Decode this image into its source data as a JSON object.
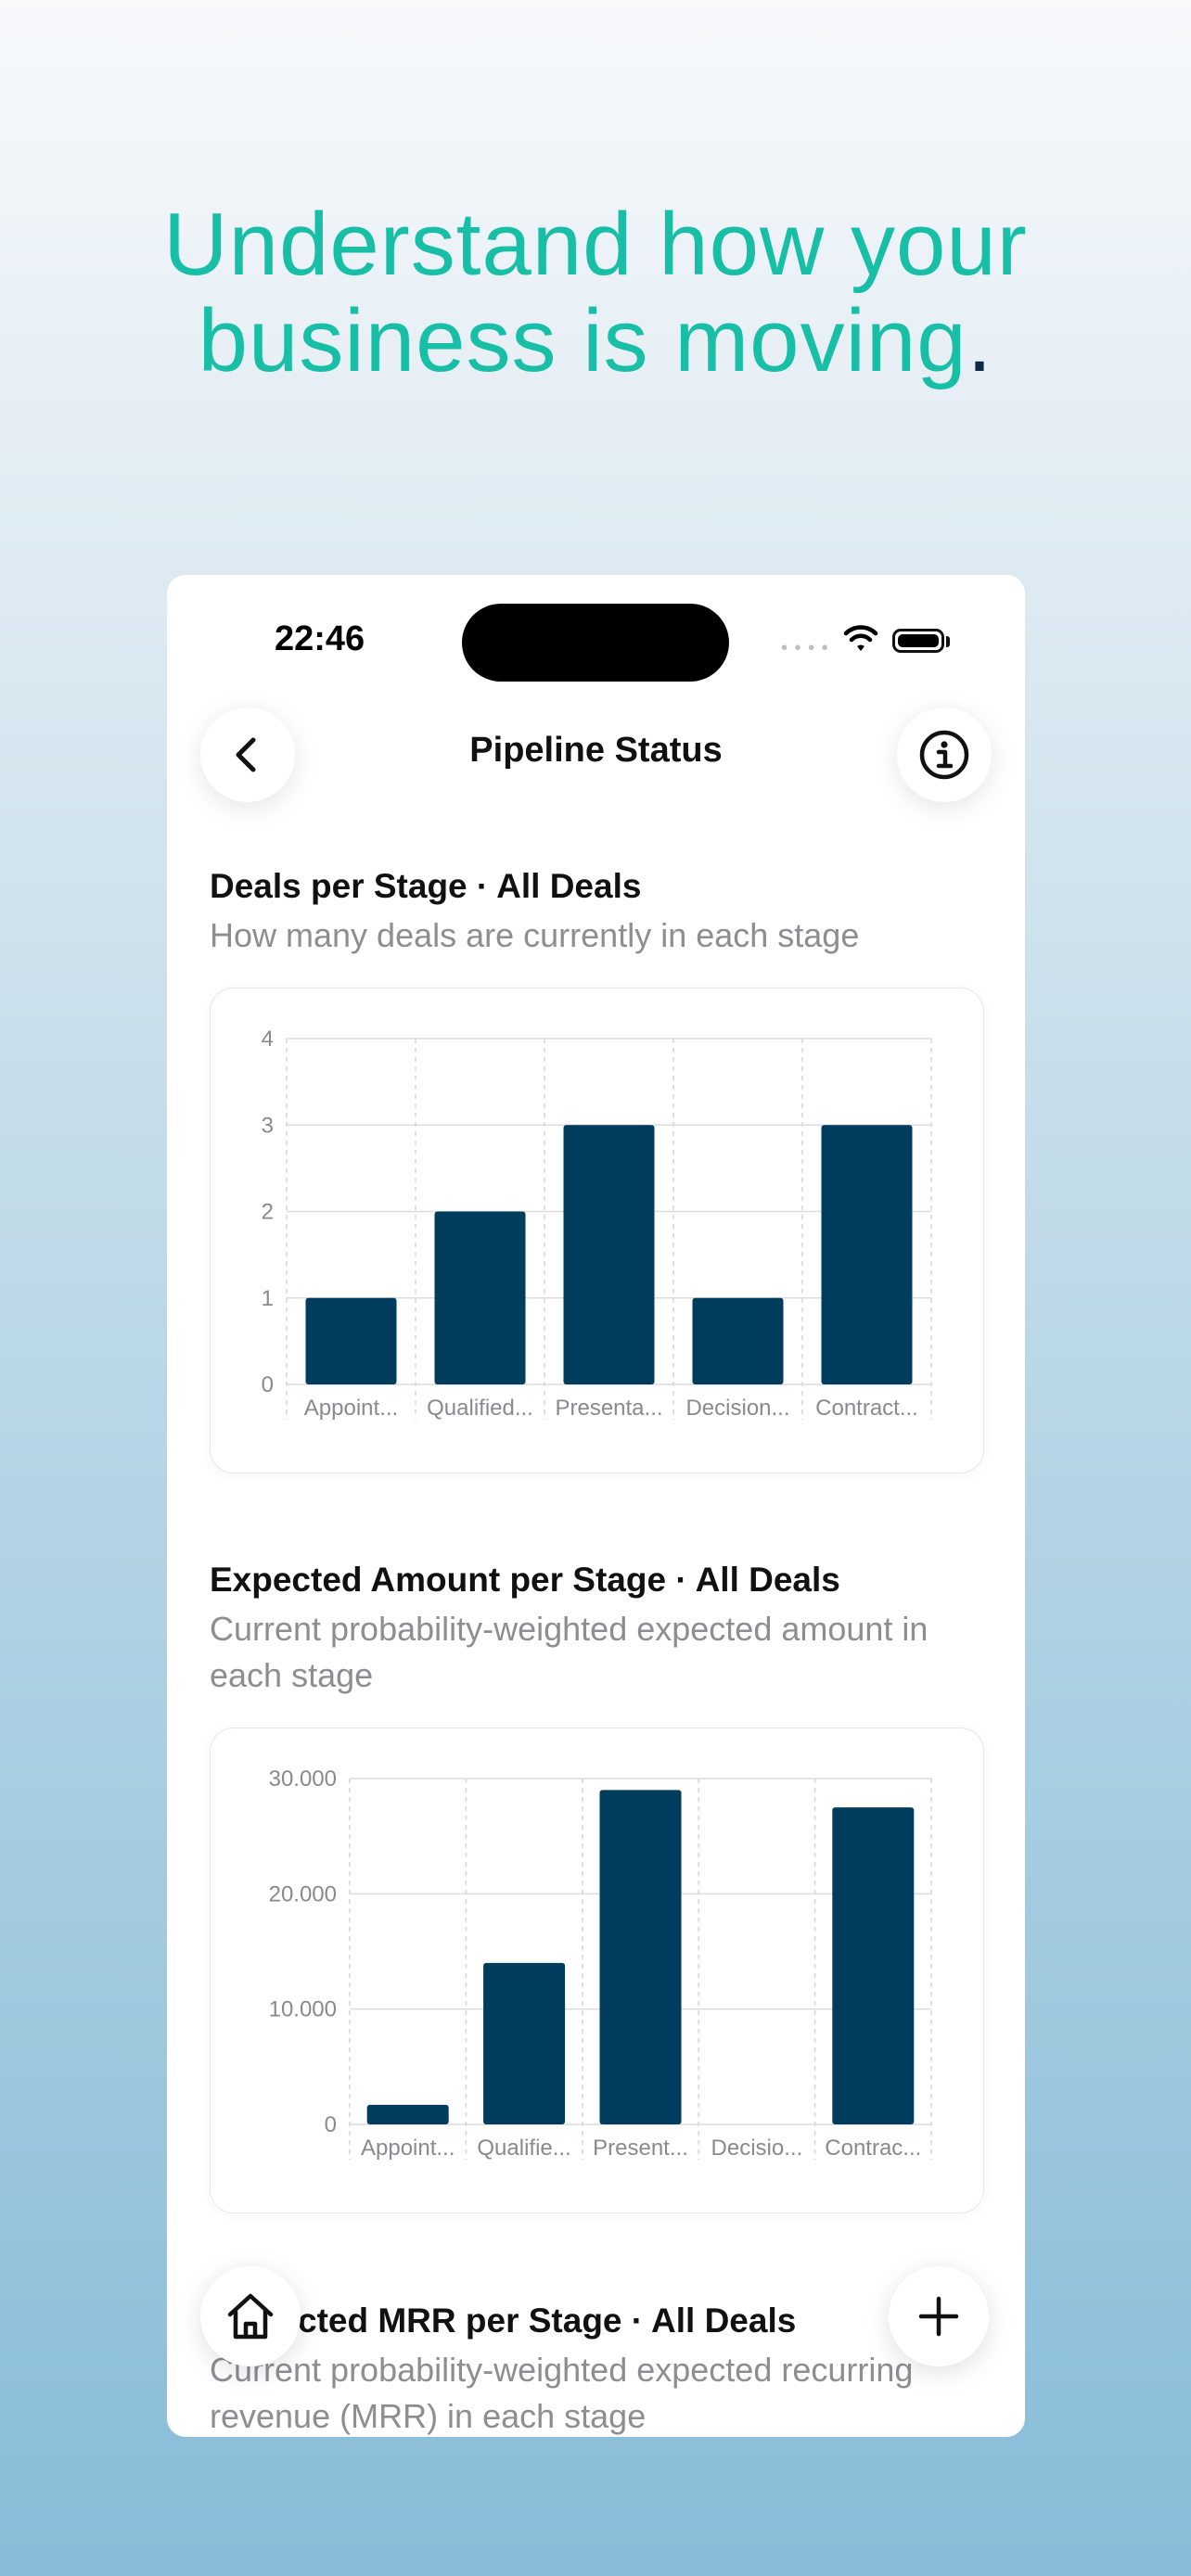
{
  "headline": {
    "line1": "Understand how your",
    "line2": "business is moving",
    "period": "."
  },
  "status_bar": {
    "time": "22:46",
    "signal_icon": "signal-dots-icon",
    "wifi_icon": "wifi-icon",
    "battery_icon": "battery-icon"
  },
  "nav": {
    "title": "Pipeline Status",
    "back_icon": "chevron-left-icon",
    "info_icon": "info-icon"
  },
  "sections": [
    {
      "title": "Deals per Stage · All Deals",
      "subtitle": "How many deals are currently in each stage"
    },
    {
      "title": "Expected Amount per Stage · All Deals",
      "subtitle": "Current probability-weighted expected amount in each stage"
    },
    {
      "title": "Expected MRR per Stage · All Deals",
      "title_visible": "cted MRR per Stage · All Deals",
      "subtitle": "Current probability-weighted expected recurring revenue (MRR) in each stage"
    }
  ],
  "chart_data": [
    {
      "type": "bar",
      "categories": [
        "Appoint...",
        "Qualified...",
        "Presenta...",
        "Decision...",
        "Contract..."
      ],
      "values": [
        1,
        2,
        3,
        1,
        3
      ],
      "ylim": [
        0,
        4
      ],
      "yticks": [
        "0",
        "1",
        "2",
        "3",
        "4"
      ],
      "bar_color": "#003c5c",
      "grid": true
    },
    {
      "type": "bar",
      "categories": [
        "Appoint...",
        "Qualifie...",
        "Present...",
        "Decisio...",
        "Contrac..."
      ],
      "values": [
        1700,
        14000,
        29000,
        0,
        27500
      ],
      "ylim": [
        0,
        30000
      ],
      "yticks": [
        "0",
        "10.000",
        "20.000",
        "30.000"
      ],
      "bar_color": "#003c5c",
      "grid": true
    }
  ],
  "bottom_bar": {
    "home_icon": "home-icon",
    "add_icon": "plus-icon"
  },
  "colors": {
    "accent": "#18bfa6",
    "bar": "#003c5c",
    "muted_text": "#8d8d92"
  }
}
